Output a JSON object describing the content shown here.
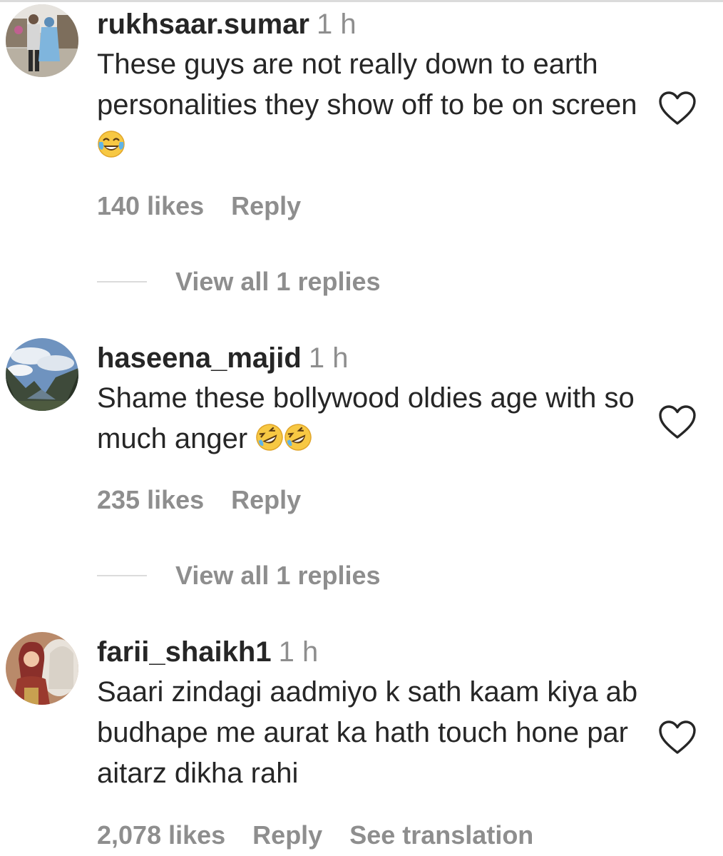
{
  "comments": [
    {
      "username": "rukhsaar.sumar",
      "time": "1 h",
      "text": "These guys are not really down to earth personalities they show off to be on screen",
      "text_emoji": "face-with-tears-of-joy",
      "likes": "140 likes",
      "reply_label": "Reply",
      "view_replies": "View all 1 replies",
      "avatar_icon": "couple-photo-avatar"
    },
    {
      "username": "haseena_majid",
      "time": "1 h",
      "text": "Shame these bollywood oldies age with so much anger ",
      "text_emoji": "rolling-on-the-floor-laughing",
      "likes": "235 likes",
      "reply_label": "Reply",
      "view_replies": "View all 1 replies",
      "avatar_icon": "mountain-landscape-avatar"
    },
    {
      "username": "farii_shaikh1",
      "time": "1 h",
      "text": "Saari zindagi aadmiyo k sath kaam kiya ab budhape me aurat ka hath touch hone par aitarz dikha rahi",
      "likes": "2,078 likes",
      "reply_label": "Reply",
      "see_translation": "See translation",
      "avatar_icon": "woman-with-horse-avatar"
    }
  ],
  "colors": {
    "text": "#262626",
    "muted": "#8e8e8e",
    "divider": "#dbdbdb"
  },
  "icons": {
    "like": "heart-outline-icon"
  }
}
